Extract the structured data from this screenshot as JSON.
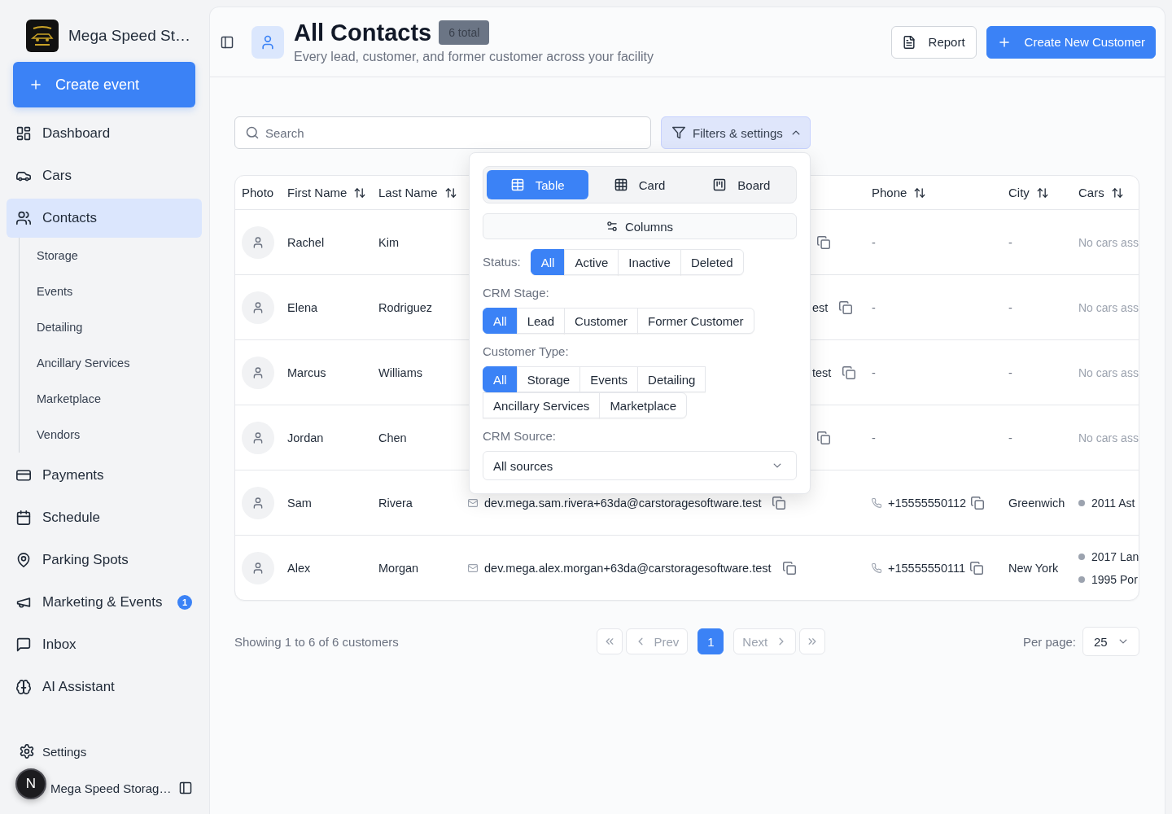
{
  "sidebar": {
    "brand": "Mega Speed St…",
    "create_button": "Create event",
    "nav": [
      {
        "label": "Dashboard",
        "selected": false
      },
      {
        "label": "Cars",
        "selected": false
      },
      {
        "label": "Contacts",
        "selected": true,
        "children": [
          {
            "label": "Storage",
            "selected": false
          },
          {
            "label": "Events",
            "selected": false
          },
          {
            "label": "Detailing",
            "selected": false
          },
          {
            "label": "Ancillary Services",
            "selected": false
          },
          {
            "label": "Marketplace",
            "selected": false
          },
          {
            "label": "Vendors",
            "selected": false
          }
        ]
      },
      {
        "label": "Payments",
        "selected": false
      },
      {
        "label": "Schedule",
        "selected": false
      },
      {
        "label": "Parking Spots",
        "selected": false
      },
      {
        "label": "Marketing & Events",
        "selected": false,
        "badge": "1"
      },
      {
        "label": "Inbox",
        "selected": false
      },
      {
        "label": "AI Assistant",
        "selected": false
      }
    ],
    "settings": "Settings",
    "account": "Mega Speed Storag…"
  },
  "dev_indicator": "N",
  "header": {
    "title": "All Contacts",
    "count": "6 total",
    "subtitle": "Every lead, customer, and former customer across your facility",
    "actions": [
      {
        "label": "Report",
        "kind": "secondary"
      },
      {
        "label": "Create New Customer",
        "kind": "primary"
      }
    ]
  },
  "toolbar": {
    "search": {
      "placeholder": "Search"
    },
    "filters_button": {
      "label": "Filters & settings",
      "expanded": true
    }
  },
  "filters_panel": {
    "views": [
      {
        "label": "Table",
        "selected": true
      },
      {
        "label": "Card",
        "selected": false
      },
      {
        "label": "Board",
        "selected": false
      }
    ],
    "columns_button": "Columns",
    "groups": [
      {
        "kind": "inline",
        "label": "Status:",
        "options": [
          {
            "label": "All",
            "selected": true
          },
          {
            "label": "Active",
            "selected": false
          },
          {
            "label": "Inactive",
            "selected": false
          },
          {
            "label": "Deleted",
            "selected": false
          }
        ]
      },
      {
        "kind": "stacked",
        "label": "CRM Stage:",
        "options": [
          {
            "label": "All",
            "selected": true
          },
          {
            "label": "Lead",
            "selected": false
          },
          {
            "label": "Customer",
            "selected": false
          },
          {
            "label": "Former Customer",
            "selected": false
          }
        ]
      },
      {
        "kind": "stacked",
        "label": "Customer Type:",
        "options": [
          {
            "label": "All",
            "selected": true
          },
          {
            "label": "Storage",
            "selected": false
          },
          {
            "label": "Events",
            "selected": false
          },
          {
            "label": "Detailing",
            "selected": false
          },
          {
            "label": "Ancillary Services",
            "selected": false
          },
          {
            "label": "Marketplace",
            "selected": false
          }
        ]
      }
    ],
    "source": {
      "label": "CRM Source:",
      "value": "All sources"
    }
  },
  "table": {
    "columns": [
      {
        "label": "Photo",
        "sortable": false
      },
      {
        "label": "First Name",
        "sortable": true
      },
      {
        "label": "Last Name",
        "sortable": true
      },
      {
        "label": "Phone",
        "sortable": true
      },
      {
        "label": "City",
        "sortable": true
      },
      {
        "label": "Cars",
        "sortable": true
      }
    ],
    "rows": [
      {
        "first_name": "Rachel",
        "last_name": "Kim",
        "phone": {
          "kind": "empty",
          "text": "-"
        },
        "city": {
          "kind": "empty",
          "text": "-"
        },
        "cars_note": "No cars ass"
      },
      {
        "first_name": "Elena",
        "last_name": "Rodriguez",
        "email": "est",
        "phone": {
          "kind": "empty",
          "text": "-"
        },
        "city": {
          "kind": "empty",
          "text": "-"
        },
        "cars_note": "No cars ass"
      },
      {
        "first_name": "Marcus",
        "last_name": "Williams",
        "email": "test",
        "phone": {
          "kind": "empty",
          "text": "-"
        },
        "city": {
          "kind": "empty",
          "text": "-"
        },
        "cars_note": "No cars ass"
      },
      {
        "first_name": "Jordan",
        "last_name": "Chen",
        "phone": {
          "kind": "empty",
          "text": "-"
        },
        "city": {
          "kind": "empty",
          "text": "-"
        },
        "cars_note": "No cars ass"
      },
      {
        "first_name": "Sam",
        "last_name": "Rivera",
        "email": "dev.mega.sam.rivera+63da@carstoragesoftware.test",
        "phone": {
          "kind": "number",
          "text": "+15555550112"
        },
        "city": {
          "kind": "value",
          "text": "Greenwich"
        },
        "cars": [
          "2011 Ast"
        ]
      },
      {
        "first_name": "Alex",
        "last_name": "Morgan",
        "email": "dev.mega.alex.morgan+63da@carstoragesoftware.test",
        "phone": {
          "kind": "number",
          "text": "+15555550111"
        },
        "city": {
          "kind": "value",
          "text": "New York"
        },
        "cars": [
          "2017 Lan",
          "1995 Por"
        ]
      }
    ]
  },
  "pagination": {
    "summary": "Showing 1 to 6 of 6 customers",
    "first_button": {
      "disabled": true
    },
    "prev_button": {
      "label": "Prev",
      "disabled": true
    },
    "pages": [
      {
        "label": "1",
        "selected": true
      }
    ],
    "next_button": {
      "label": "Next",
      "disabled": true
    },
    "last_button": {
      "disabled": true
    },
    "per_page": {
      "label": "Per page:",
      "value": "25"
    }
  }
}
